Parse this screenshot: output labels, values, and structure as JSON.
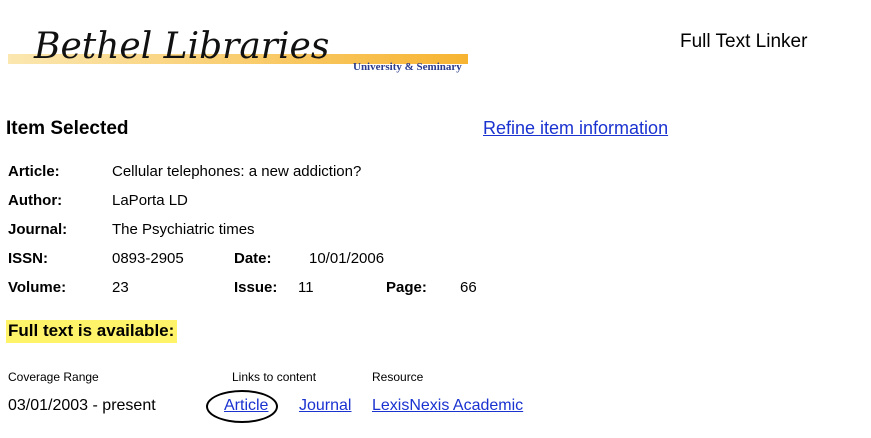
{
  "header": {
    "logo_text": "Bethel Libraries",
    "logo_subtext": "University & Seminary",
    "title": "Full Text Linker"
  },
  "item": {
    "section_title": "Item Selected",
    "refine_link": "Refine item information",
    "fields": {
      "article_label": "Article:",
      "article_value": "Cellular telephones: a new addiction?",
      "author_label": "Author:",
      "author_value": "LaPorta LD",
      "journal_label": "Journal:",
      "journal_value": "The Psychiatric times",
      "issn_label": "ISSN:",
      "issn_value": "0893-2905",
      "date_label": "Date:",
      "date_value": "10/01/2006",
      "volume_label": "Volume:",
      "volume_value": "23",
      "issue_label": "Issue:",
      "issue_value": "11",
      "page_label": "Page:",
      "page_value": "66"
    }
  },
  "fulltext": {
    "banner": "Full text is available:",
    "columns": {
      "coverage": "Coverage Range",
      "links": "Links to content",
      "resource": "Resource"
    },
    "row": {
      "coverage": "03/01/2003 - present",
      "link_article": "Article",
      "link_journal": "Journal",
      "resource": "LexisNexis Academic"
    }
  },
  "colors": {
    "link": "#1a32d0",
    "highlight": "#fff36a",
    "logo_gradient_start": "#fbe7b0",
    "logo_gradient_end": "#f7b431",
    "logo_subtext": "#2a3a8c"
  }
}
